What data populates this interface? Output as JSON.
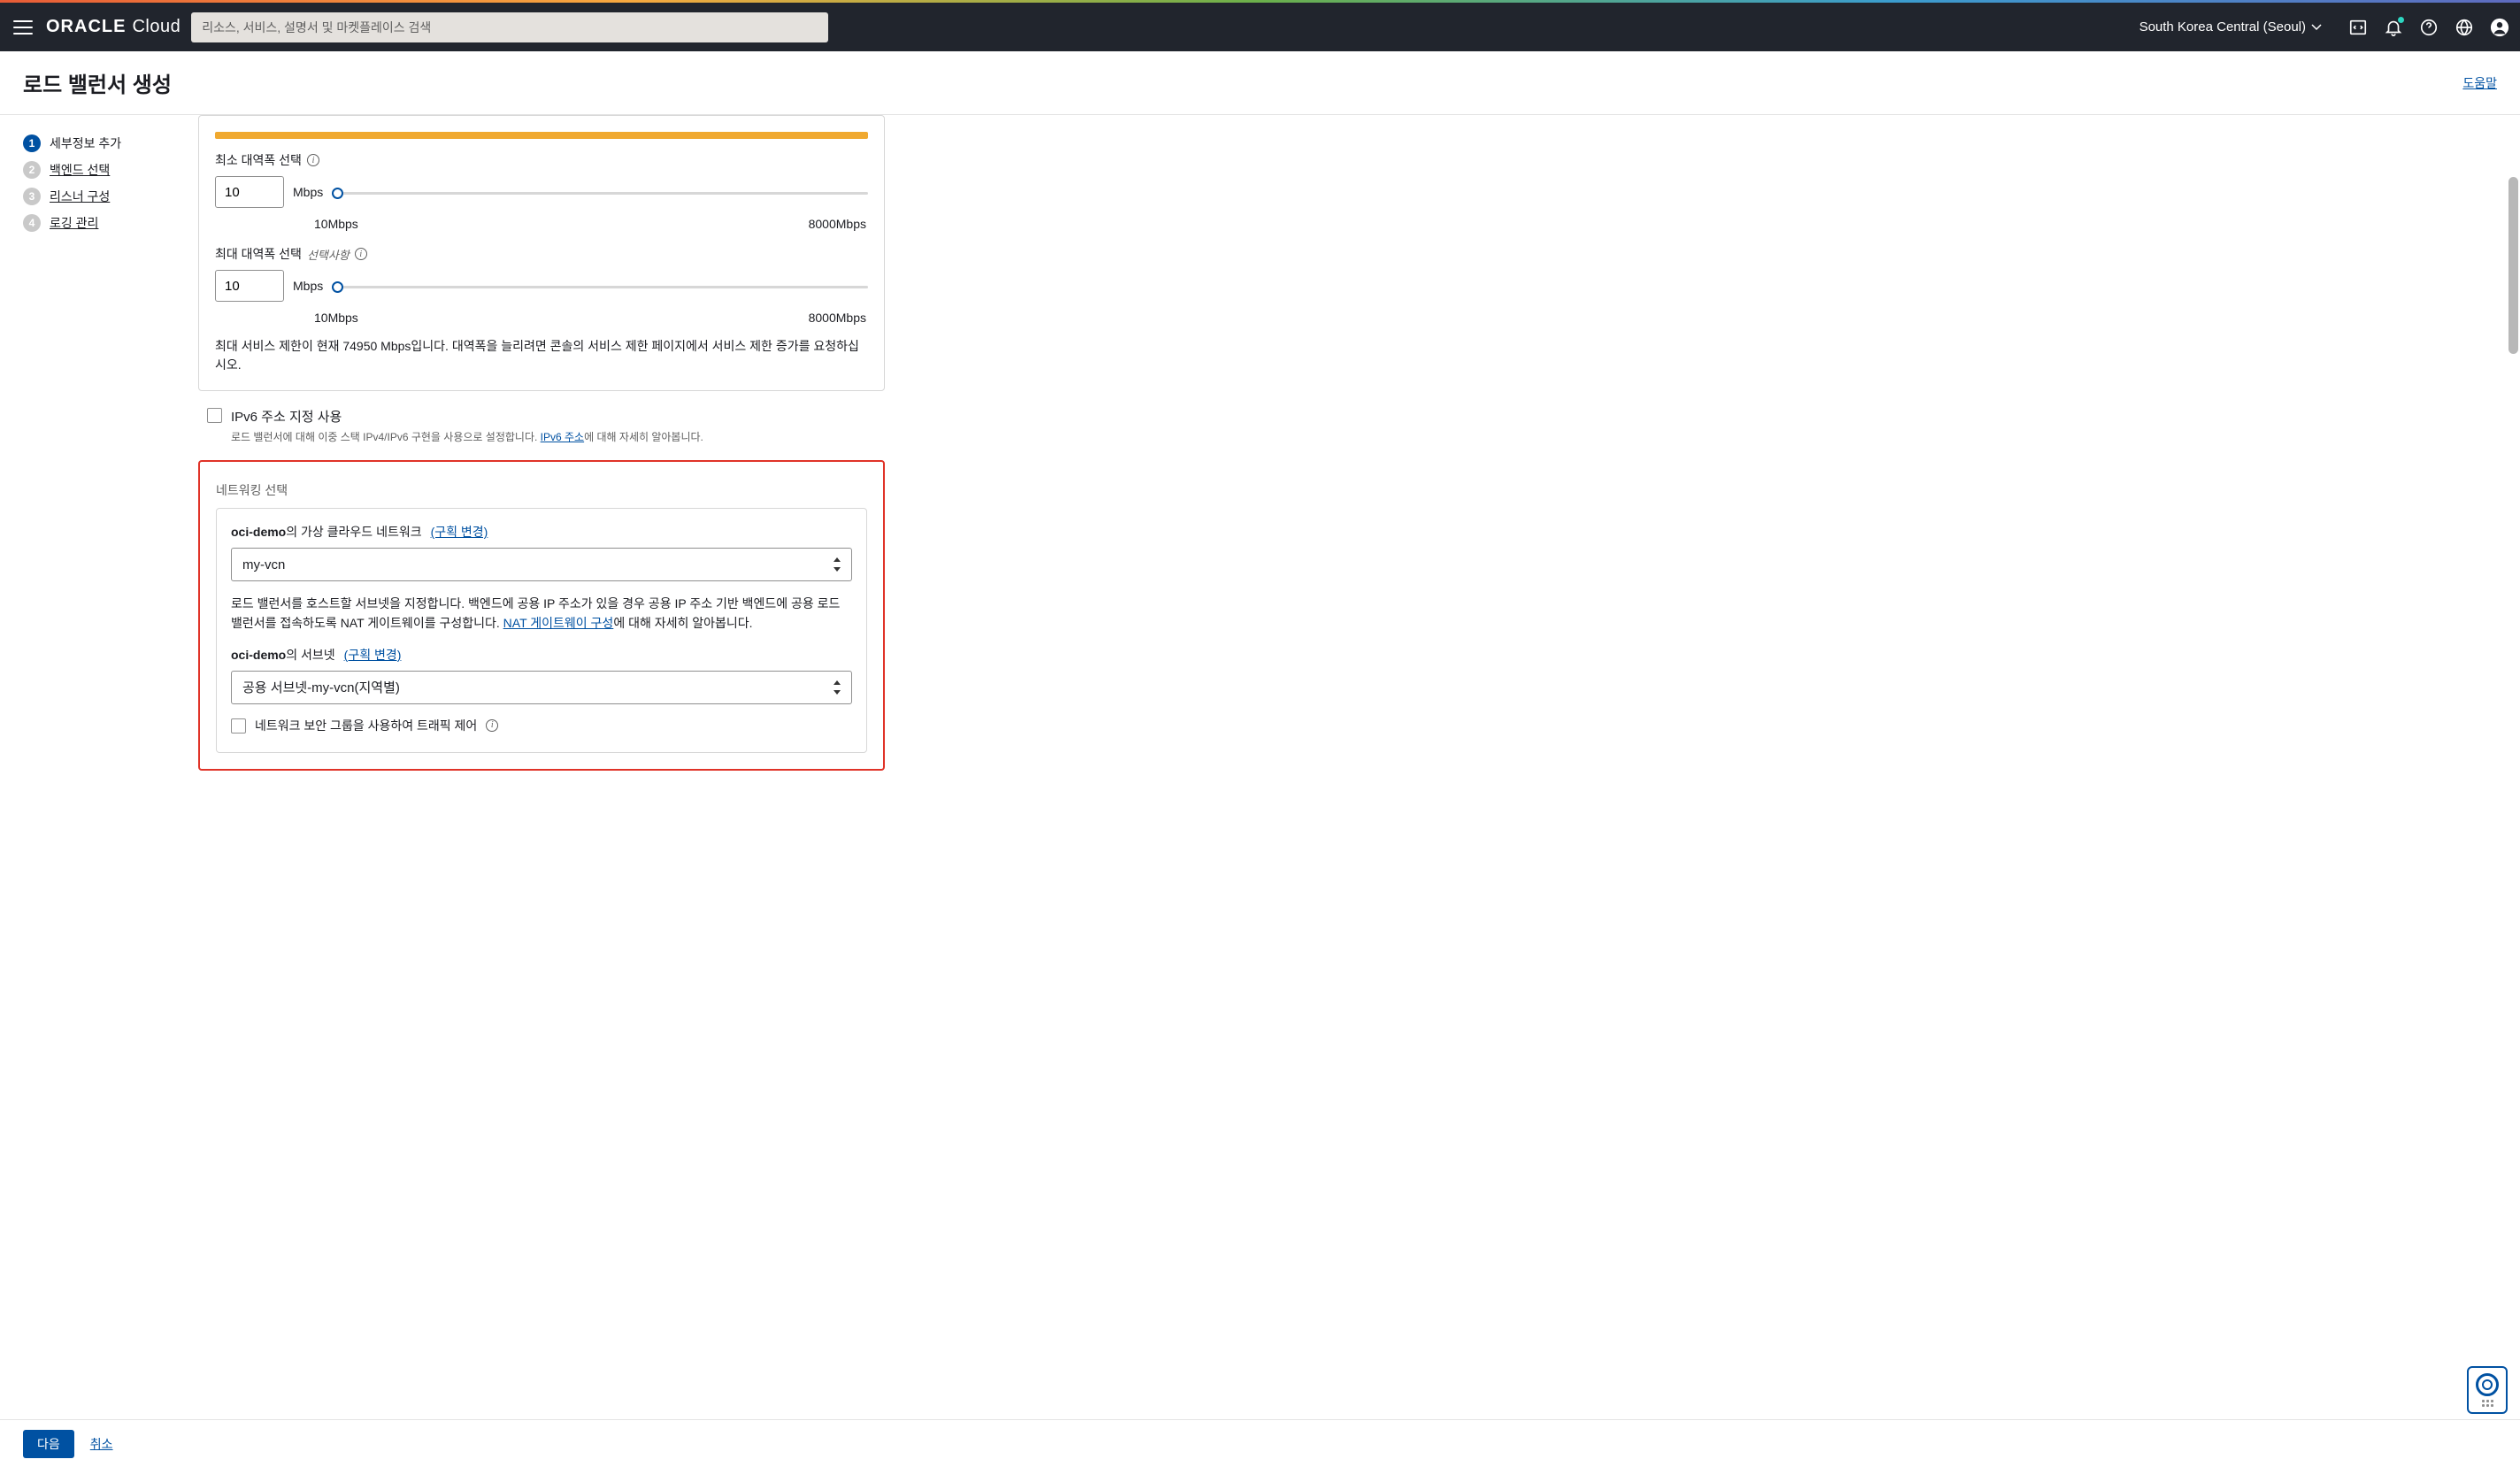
{
  "header": {
    "logo_primary": "ORACLE",
    "logo_secondary": "Cloud",
    "search_placeholder": "리소스, 서비스, 설명서 및 마켓플레이스 검색",
    "region": "South Korea Central (Seoul)"
  },
  "page": {
    "title": "로드 밸런서 생성",
    "help": "도움말"
  },
  "steps": [
    {
      "num": "1",
      "label": "세부정보 추가",
      "active": true
    },
    {
      "num": "2",
      "label": "백엔드 선택",
      "active": false
    },
    {
      "num": "3",
      "label": "리스너 구성",
      "active": false
    },
    {
      "num": "4",
      "label": "로깅 관리",
      "active": false
    }
  ],
  "bandwidth": {
    "min_label": "최소 대역폭 선택",
    "min_value": "10",
    "max_label": "최대 대역폭 선택",
    "max_optional": "선택사항",
    "max_value": "10",
    "unit": "Mbps",
    "slider_min": "10Mbps",
    "slider_max": "8000Mbps",
    "limit_text": "최대 서비스 제한이 현재 74950 Mbps입니다. 대역폭을 늘리려면 콘솔의 서비스 제한 페이지에서 서비스 제한 증가를 요청하십시오."
  },
  "ipv6": {
    "label": "IPv6 주소 지정 사용",
    "help_prefix": "로드 밸런서에 대해 이중 스택 IPv4/IPv6 구현을 사용으로 설정합니다. ",
    "help_link": "IPv6 주소",
    "help_suffix": "에 대해 자세히 알아봅니다."
  },
  "networking": {
    "section_title": "네트워킹 선택",
    "vcn_label_bold": "oci-demo",
    "vcn_label_rest": "의 가상 클라우드 네트워크",
    "change_compartment": "(구획 변경)",
    "vcn_value": "my-vcn",
    "subnet_desc_prefix": "로드 밸런서를 호스트할 서브넷을 지정합니다. 백엔드에 공용 IP 주소가 있을 경우 공용 IP 주소 기반 백엔드에 공용 로드 밸런서를 접속하도록 NAT 게이트웨이를 구성합니다. ",
    "subnet_desc_link": "NAT 게이트웨이 구성",
    "subnet_desc_suffix": "에 대해 자세히 알아봅니다.",
    "subnet_label_bold": "oci-demo",
    "subnet_label_rest": "의 서브넷",
    "subnet_value": "공용 서브넷-my-vcn(지역별)",
    "nsg_label": "네트워크 보안 그룹을 사용하여 트래픽 제어"
  },
  "footer": {
    "next": "다음",
    "cancel": "취소"
  }
}
